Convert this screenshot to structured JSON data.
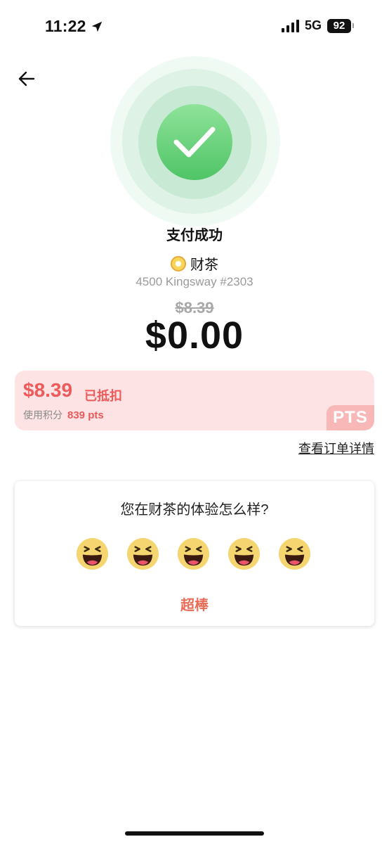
{
  "status": {
    "time": "11:22",
    "network": "5G",
    "battery": "92"
  },
  "header": {
    "title": "支付成功"
  },
  "store": {
    "name": "财茶",
    "address": "4500 Kingsway #2303"
  },
  "payment": {
    "original_price": "$8.39",
    "total": "$0.00"
  },
  "points": {
    "amount": "$8.39",
    "tag": "已抵扣",
    "used_label": "使用积分",
    "used_value": "839 pts",
    "badge": "PTS"
  },
  "order_link": "查看订单详情",
  "rating": {
    "question": "您在财茶的体验怎么样?",
    "emojis": [
      "laughing-face",
      "laughing-face",
      "laughing-face",
      "laughing-face",
      "laughing-face"
    ],
    "selected_label": "超棒"
  },
  "colors": {
    "accent_green": "#4fc466",
    "points_red": "#ec5a5a",
    "rating_orange": "#ea6b57"
  }
}
